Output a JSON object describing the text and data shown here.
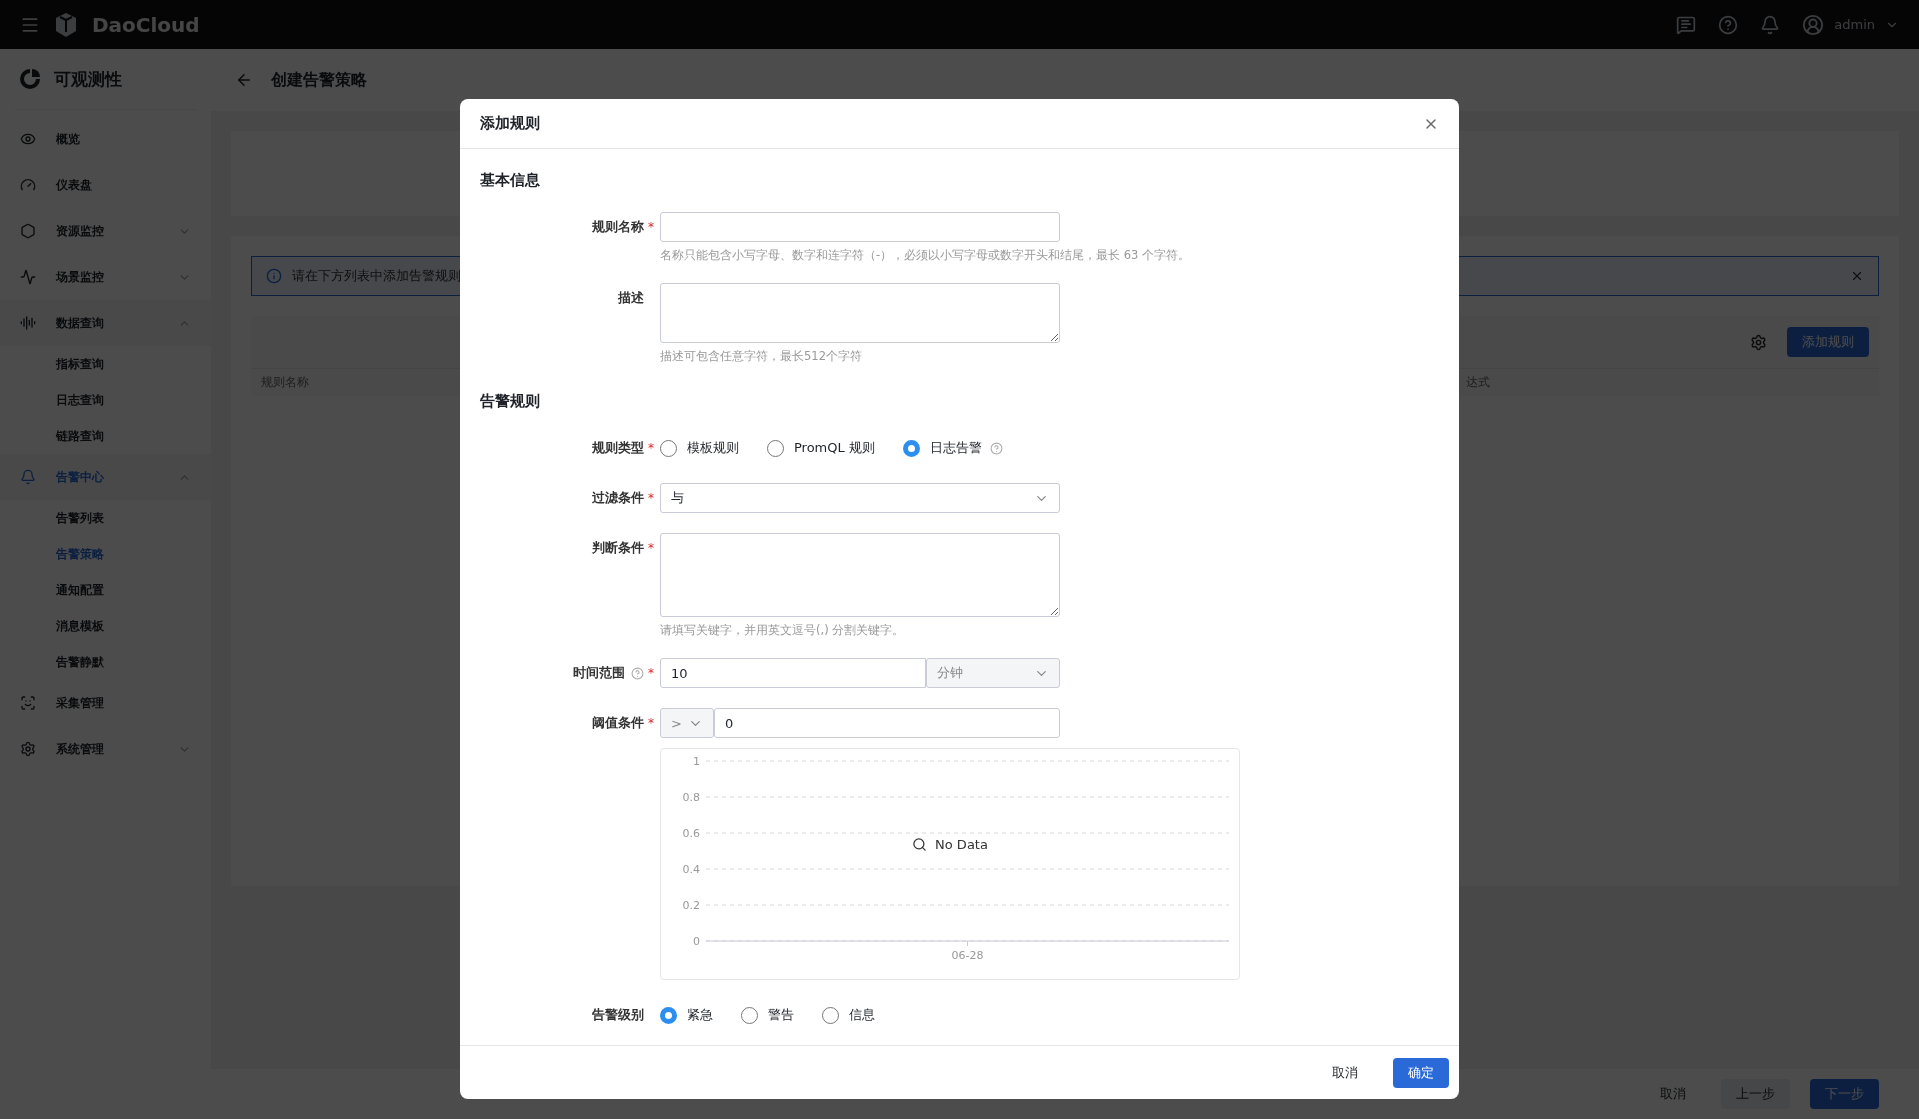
{
  "topbar": {
    "brand": "DaoCloud",
    "user": "admin"
  },
  "sidebar": {
    "title": "可观测性",
    "items": [
      {
        "label": "概览",
        "selected": false
      },
      {
        "label": "仪表盘",
        "selected": false
      },
      {
        "label": "资源监控",
        "selected": false,
        "expanded": false
      },
      {
        "label": "场景监控",
        "selected": false,
        "expanded": false
      },
      {
        "label": "数据查询",
        "selected": false,
        "expanded": true,
        "children": [
          {
            "label": "指标查询",
            "selected": false
          },
          {
            "label": "日志查询",
            "selected": false
          },
          {
            "label": "链路查询",
            "selected": false
          }
        ]
      },
      {
        "label": "告警中心",
        "selected": true,
        "expanded": true,
        "children": [
          {
            "label": "告警列表",
            "selected": false
          },
          {
            "label": "告警策略",
            "selected": true
          },
          {
            "label": "通知配置",
            "selected": false
          },
          {
            "label": "消息模板",
            "selected": false
          },
          {
            "label": "告警静默",
            "selected": false
          }
        ]
      },
      {
        "label": "采集管理",
        "selected": false
      },
      {
        "label": "系统管理",
        "selected": false,
        "expanded": false
      }
    ]
  },
  "page": {
    "title": "创建告警策略",
    "alert": "请在下方列表中添加告警规则",
    "add_button": "添加规则",
    "table": {
      "columns": [
        "规则名称",
        "达式"
      ]
    },
    "footer": {
      "cancel": "取消",
      "prev": "上一步",
      "next": "下一步"
    }
  },
  "dialog": {
    "title": "添加规则",
    "sections": [
      {
        "title": "基本信息",
        "fields": [
          {
            "kind": "input",
            "label": "规则名称",
            "required_mark": "*",
            "hint": "名称只能包含小写字母、数字和连字符（-），必须以小写字母或数字开头和结尾，最长 63 个字符。"
          },
          {
            "kind": "textarea",
            "label": "描述",
            "hint": "描述可包含任意字符，最长512个字符"
          }
        ]
      },
      {
        "title": "告警规则",
        "fields": [
          {
            "kind": "radio",
            "label": "规则类型",
            "required_mark": "*",
            "help": true,
            "options": [
              {
                "label": "模板规则",
                "selected": false
              },
              {
                "label": "PromQL 规则",
                "selected": false
              },
              {
                "label": "日志告警",
                "selected": true
              }
            ]
          },
          {
            "kind": "select",
            "label": "过滤条件",
            "required_mark": "*",
            "value": "与"
          },
          {
            "kind": "textarea",
            "label": "判断条件",
            "required_mark": "*",
            "hint": "请填写关键字，并用英文逗号(,) 分割关键字。"
          },
          {
            "kind": "duration",
            "label": "时间范围",
            "required_mark": "*",
            "value": "10",
            "unit": "分钟"
          },
          {
            "kind": "threshold",
            "label": "阈值条件",
            "required_mark": "*",
            "operator": ">",
            "value": "0"
          },
          {
            "kind": "chart",
            "empty_text": "No Data",
            "chart_data": {
              "type": "line",
              "grid": true,
              "categories": [
                "06-28"
              ],
              "ylim": [
                0,
                1
              ],
              "yticks": [
                {
                  "value": 0,
                  "label": "0"
                },
                {
                  "value": 0.2,
                  "label": "0.2"
                },
                {
                  "value": 0.4,
                  "label": "0.4"
                },
                {
                  "value": 0.6,
                  "label": "0.6"
                },
                {
                  "value": 0.8,
                  "label": "0.8"
                },
                {
                  "value": 1,
                  "label": "1"
                }
              ]
            }
          },
          {
            "kind": "radio",
            "label": "告警级别",
            "options": [
              {
                "label": "紧急",
                "selected": true
              },
              {
                "label": "警告",
                "selected": false
              },
              {
                "label": "信息",
                "selected": false
              }
            ]
          }
        ]
      }
    ],
    "buttons": {
      "cancel": "取消",
      "ok": "确定"
    }
  }
}
